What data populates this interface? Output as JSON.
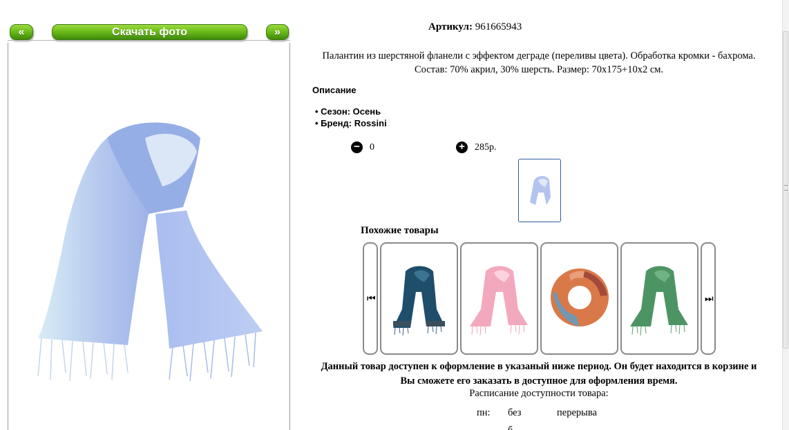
{
  "gallery": {
    "prev_label": "«",
    "download_label": "Скачать фото",
    "next_label": "»"
  },
  "product": {
    "sku_label": "Артикул:",
    "sku_value": "961665943",
    "description_line1": "Палантин из шерстяной фланели с эффектом деграде (переливы цвета). Обработка кромки - бахрома.",
    "description_line2": "Состав: 70% акрил, 30% шерсть. Размер: 70х175+10х2 см.",
    "description_heading": "Описание",
    "properties": [
      "Сезон: Осень",
      "Бренд: Rossini"
    ],
    "quantity": "0",
    "price": "285р.",
    "main_color": "#a6b8e8"
  },
  "similar": {
    "title": "Похожие товары",
    "items": [
      {
        "icon": "navy-scarf-image",
        "color": "#1f4e6b"
      },
      {
        "icon": "pink-scarf-image",
        "color": "#f2a3b8"
      },
      {
        "icon": "orange-snood-image",
        "color": "#d9794a"
      },
      {
        "icon": "green-scarf-image",
        "color": "#4d9464"
      }
    ]
  },
  "availability": {
    "notice_line1": "Данный товар доступен к оформление в указаный ниже период. Он будет находится в корзине и",
    "notice_line2": "Вы сможете его заказать в доступное для оформления время.",
    "schedule_title": "Расписание доступности товара:",
    "rows": [
      {
        "day": "пн:",
        "from": "без",
        "to": "перерыва"
      }
    ],
    "cut_text": "б"
  }
}
